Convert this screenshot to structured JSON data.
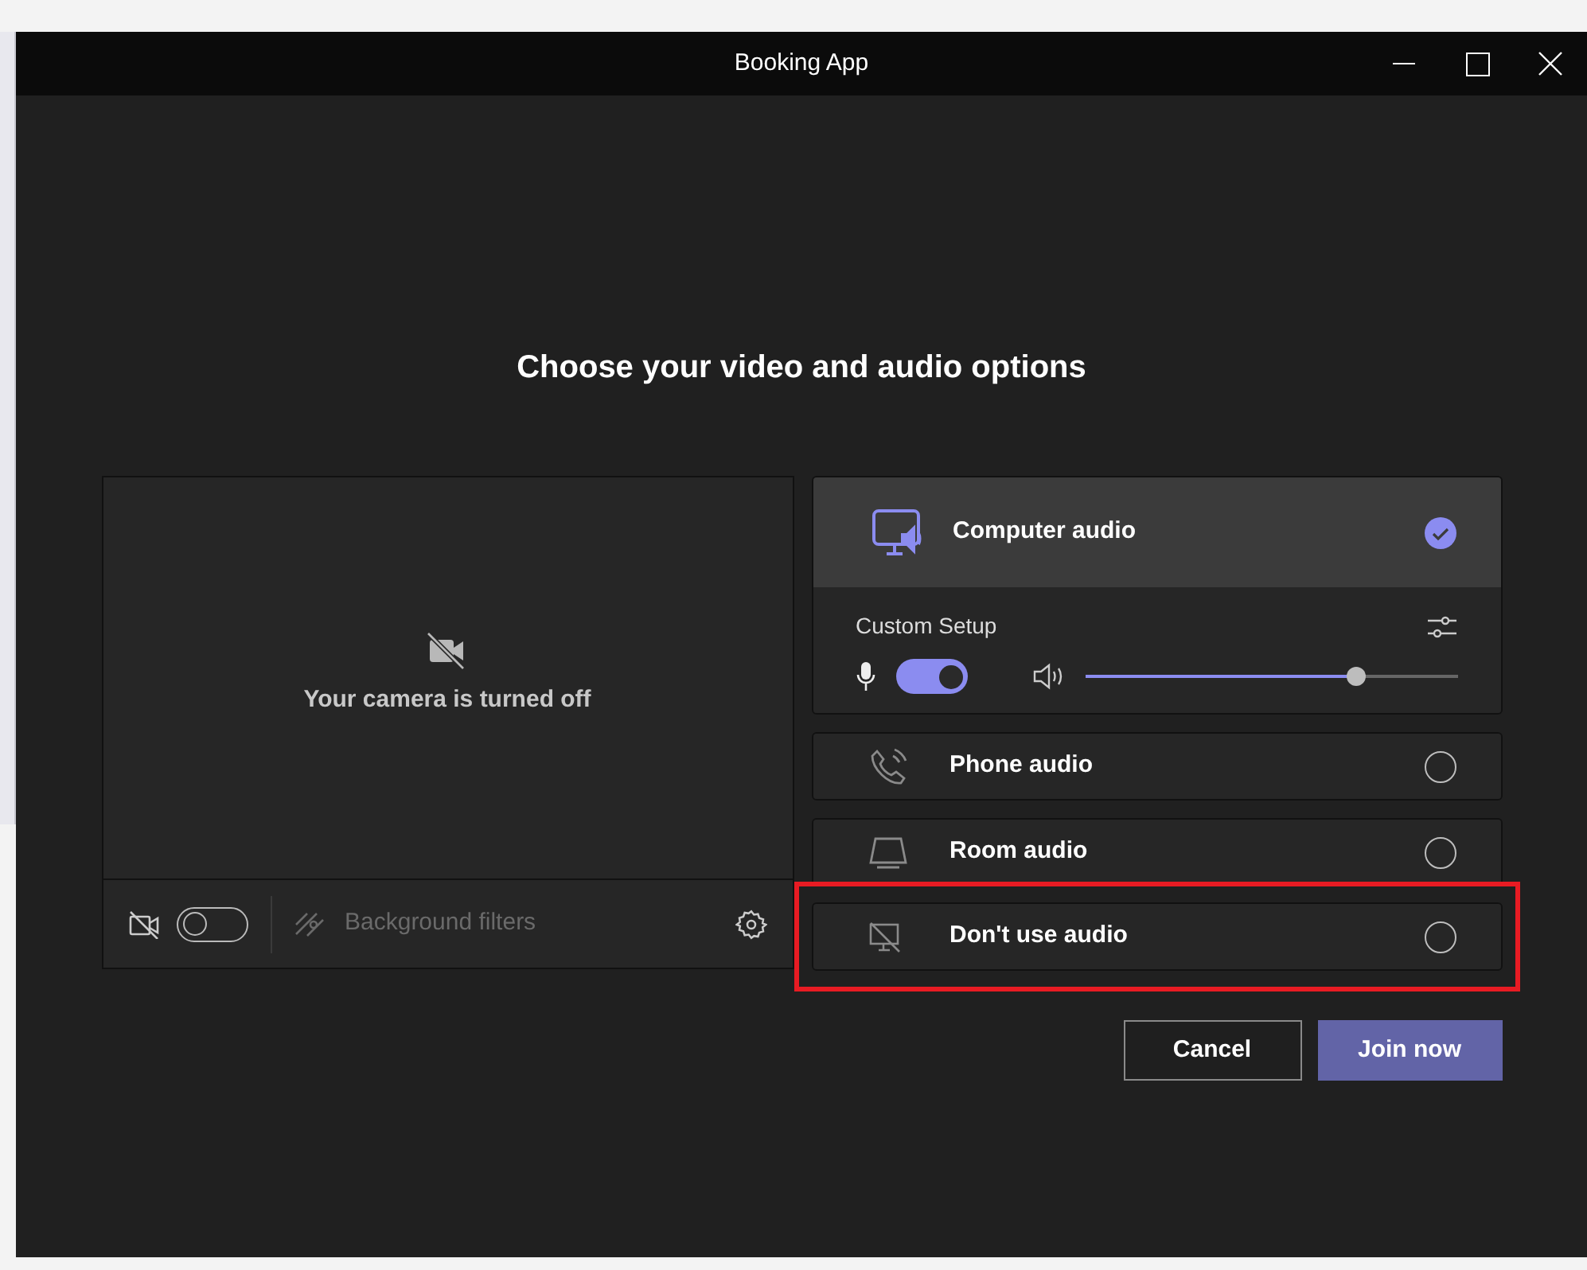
{
  "window": {
    "title": "Booking App"
  },
  "heading": "Choose your video and audio options",
  "camera": {
    "message": "Your camera is turned off",
    "on": false,
    "background_filters": {
      "label": "Background filters",
      "disabled": true
    }
  },
  "audio_options": [
    {
      "kind": "computer",
      "label": "Computer audio",
      "selected": true,
      "highlighted": false,
      "setup": {
        "label": "Custom Setup",
        "mic_on": true,
        "level": 0.73
      }
    },
    {
      "kind": "phone",
      "label": "Phone audio",
      "selected": false,
      "highlighted": false
    },
    {
      "kind": "room",
      "label": "Room audio",
      "selected": false,
      "highlighted": false
    },
    {
      "kind": "none",
      "label": "Don't use audio",
      "selected": false,
      "highlighted": true
    }
  ],
  "buttons": [
    {
      "kind": "secondary",
      "label": "Cancel"
    },
    {
      "kind": "primary",
      "label": "Join now"
    }
  ]
}
